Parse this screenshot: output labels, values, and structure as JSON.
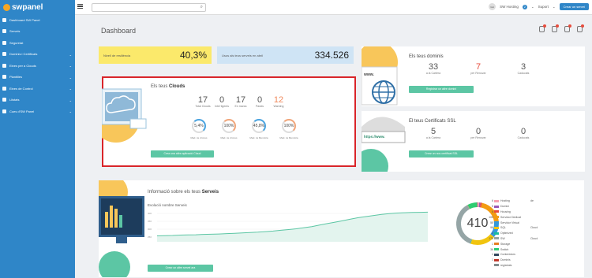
{
  "logo": "swpanel",
  "sidebar": {
    "items": [
      {
        "label": "Dashboard SW Panel",
        "chev": ""
      },
      {
        "label": "Serveis",
        "chev": ""
      },
      {
        "label": "Seguretat",
        "chev": ""
      },
      {
        "label": "Dominis i Certificats",
        "chev": "⌄"
      },
      {
        "label": "Eines per a Clouds",
        "chev": "⌄"
      },
      {
        "label": "Plantilles",
        "chev": "⌄"
      },
      {
        "label": "Eines de Control",
        "chev": "⌄"
      },
      {
        "label": "Llistats",
        "chev": "⌄"
      },
      {
        "label": "Cues d'SW Panel",
        "chev": "⌄"
      }
    ]
  },
  "topbar": {
    "avatar": "GH",
    "user": "SW Hosting",
    "badge": "2",
    "support": "Suport",
    "new_service": "Crear un servei"
  },
  "title": "Dashboard",
  "alerts": {
    "icons": [
      "bell-icon",
      "info-icon",
      "warning-icon",
      "message-icon"
    ]
  },
  "kpi": {
    "yellow_label": "Nivell de resiliència",
    "yellow_value": "40,3%",
    "blue_label": "Usos als teus serveis en abril",
    "blue_value": "334.526"
  },
  "clouds": {
    "title_pre": "Els teus ",
    "title_b": "Clouds",
    "stats": [
      {
        "n": "17",
        "l": "Total Clouds",
        "c": "#555"
      },
      {
        "n": "0",
        "l": "Intel·ligents",
        "c": "#555"
      },
      {
        "n": "17",
        "l": "En marxa",
        "c": "#555"
      },
      {
        "n": "0",
        "l": "Parats",
        "c": "#555"
      },
      {
        "n": "12",
        "l": "Warning",
        "c": "#f08a5d"
      }
    ],
    "gauges": [
      {
        "v": "5,4%",
        "l": "Mad. ús vCores"
      },
      {
        "v": "100%",
        "l": "Mad. ús vCores"
      },
      {
        "v": "45,8%",
        "l": "Mad. ús Memòria"
      },
      {
        "v": "100%",
        "l": "Mad. ús Memòria"
      }
    ],
    "button": "Crea una altra aplicació Cloud"
  },
  "domains": {
    "title": "Els teus dominis",
    "stats": [
      {
        "n": "33",
        "l": "a la Cartera",
        "c": "#555"
      },
      {
        "n": "7",
        "l": "per Renovar",
        "c": "#e74c3c"
      },
      {
        "n": "3",
        "l": "Caducats",
        "c": "#555"
      }
    ],
    "button": "Registrar un altre domini",
    "www": "www."
  },
  "ssl": {
    "title": "El teus Certificats SSL",
    "stats": [
      {
        "n": "5",
        "l": "a la Cartera",
        "c": "#555"
      },
      {
        "n": "0",
        "l": "per Renovar",
        "c": "#555"
      },
      {
        "n": "0",
        "l": "Caducats",
        "c": "#555"
      }
    ],
    "button": "Crear un nou certificat SSL",
    "url": "https://www."
  },
  "serveis": {
    "title_pre": "Informació sobre els teus ",
    "title_b": "Serveis",
    "subtitle": "Evolució nombre Serveis",
    "button": "Crear un altre servei ara",
    "total": "410",
    "legend": [
      {
        "n": "6",
        "l": "Hosting",
        "c": "#f5a0b0",
        "x": "de"
      },
      {
        "n": "5",
        "l": "Domini",
        "c": "#9b59b6",
        "x": ""
      },
      {
        "n": "6",
        "l": "Housing",
        "c": "#e74c3c",
        "x": ""
      },
      {
        "n": "105",
        "l": "Servidor Dedicat",
        "c": "#f39c12",
        "x": ""
      },
      {
        "n": "55",
        "l": "Servidor Virtual",
        "c": "#3498db",
        "x": ""
      },
      {
        "n": "96",
        "l": "SQL",
        "c": "#f1c40f",
        "x": "Cloud"
      },
      {
        "n": "2",
        "l": "Optimized",
        "c": "#1abc9c",
        "x": ""
      },
      {
        "n": "179",
        "l": "SW",
        "c": "#95a5a6",
        "x": "Cloud"
      },
      {
        "n": "1",
        "l": "Storage",
        "c": "#e67e22",
        "x": ""
      },
      {
        "n": "36",
        "l": "Switch",
        "c": "#2ecc71",
        "x": ""
      },
      {
        "n": "1",
        "l": "Contenidors",
        "c": "#34495e",
        "x": ""
      },
      {
        "n": "1",
        "l": "Dominis",
        "c": "#c0392b",
        "x": ""
      },
      {
        "n": "",
        "l": "registrats",
        "c": "#7f8c8d",
        "x": ""
      }
    ]
  },
  "chart_data": {
    "type": "area",
    "title": "Evolució nombre Serveis",
    "ylabels": [
      "400",
      "350",
      "300",
      "250"
    ],
    "values": [
      282,
      283,
      284,
      286,
      287,
      288,
      290,
      291,
      292,
      294,
      296,
      298,
      300,
      302,
      305,
      308,
      312,
      316,
      320,
      326,
      332,
      340,
      348,
      356,
      364,
      372,
      380,
      386,
      392,
      398,
      402,
      405,
      407,
      408,
      409,
      410
    ]
  }
}
